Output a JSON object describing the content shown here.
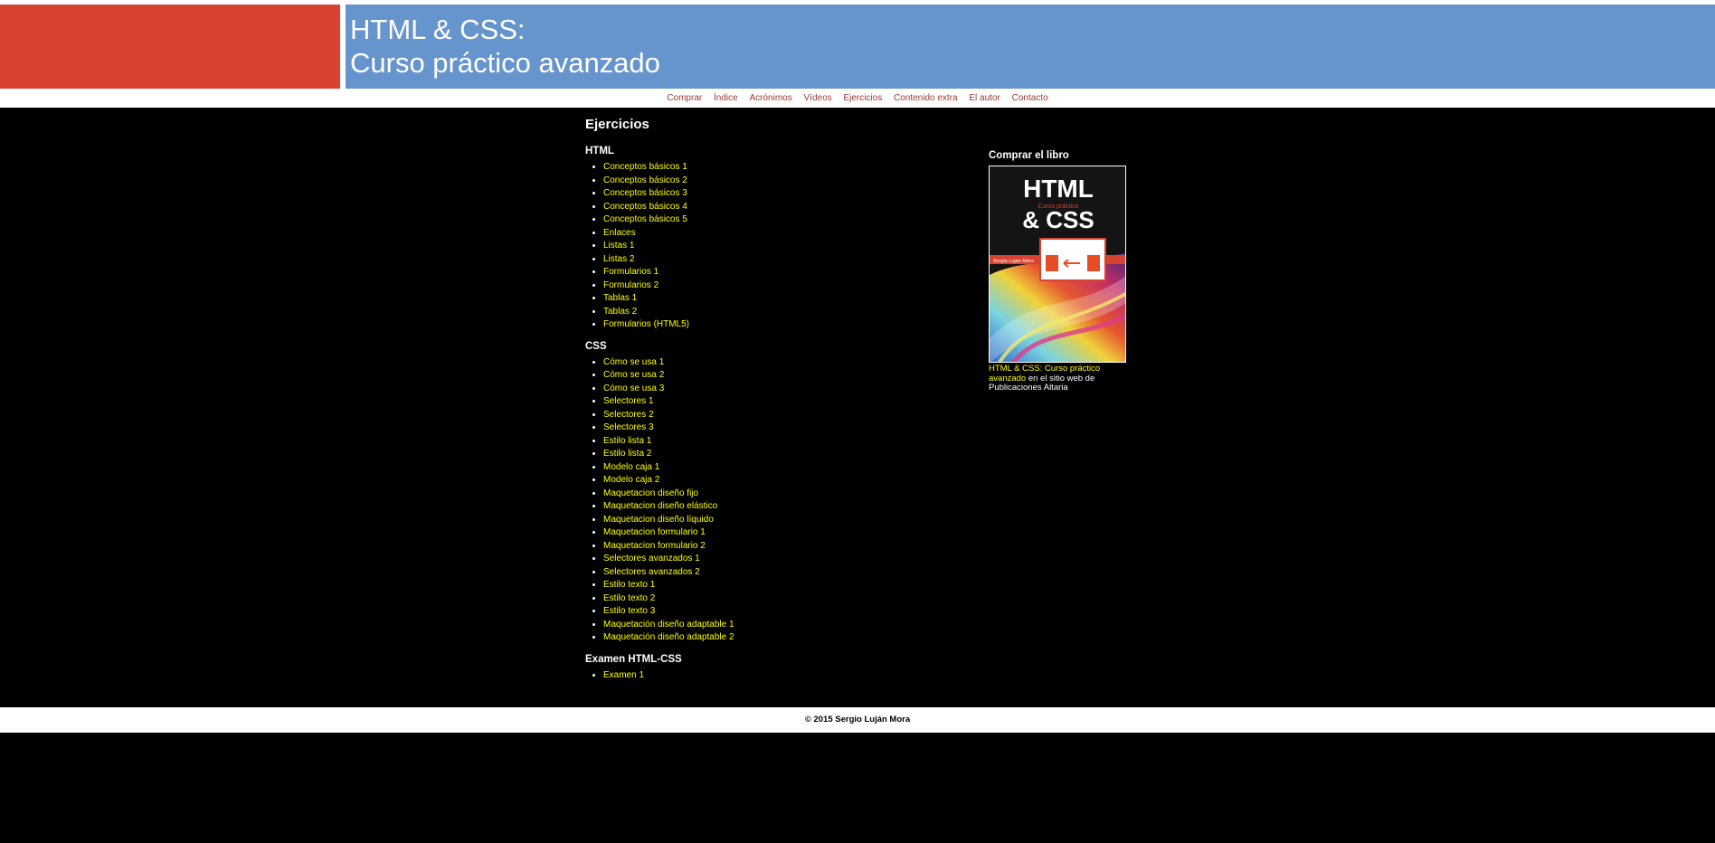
{
  "header": {
    "title_line1": "HTML & CSS:",
    "title_line2": "Curso práctico avanzado"
  },
  "nav": {
    "items": [
      "Comprar",
      "Índice",
      "Acrónimos",
      "Vídeos",
      "Ejercicios",
      "Contenido extra",
      "El autor",
      "Contacto"
    ]
  },
  "main": {
    "page_title": "Ejercicios",
    "sections": [
      {
        "title": "HTML",
        "items": [
          "Conceptos básicos 1",
          "Conceptos básicos 2",
          "Conceptos básicos 3",
          "Conceptos básicos 4",
          "Conceptos básicos 5",
          "Enlaces",
          "Listas 1",
          "Listas 2",
          "Formularios 1",
          "Formularios 2",
          "Tablas 1",
          "Tablas 2",
          "Formularios (HTML5)"
        ]
      },
      {
        "title": "CSS",
        "items": [
          "Cómo se usa 1",
          "Cómo se usa 2",
          "Cómo se usa 3",
          "Selectores 1",
          "Selectores 2",
          "Selectores 3",
          "Estilo lista 1",
          "Estilo lista 2",
          "Modelo caja 1",
          "Modelo caja 2",
          "Maquetacion diseño fijo",
          "Maquetacion diseño elástico",
          "Maquetacion diseño líquido",
          "Maquetacion formulario 1",
          "Maquetacion formulario 2",
          "Selectores avanzados 1",
          "Selectores avanzados 2",
          "Estilo texto 1",
          "Estilo texto 2",
          "Estilo texto 3",
          "Maquetación diseño adaptable 1",
          "Maquetación diseño adaptable 2"
        ]
      },
      {
        "title": "Examen HTML-CSS",
        "items": [
          "Examen 1"
        ]
      }
    ]
  },
  "sidebar": {
    "title": "Comprar el libro",
    "book": {
      "cover_title_1": "HTML",
      "cover_subtitle": "Curso práctico",
      "cover_title_2": "& CSS",
      "cover_author": "Sergio Luján Mora"
    },
    "caption_link": "HTML & CSS: Curso práctico avanzado",
    "caption_rest": " en el sitio web de Publicaciones Altaria"
  },
  "footer": {
    "text": "© 2015 Sergio Luján Mora"
  },
  "colors": {
    "header_red": "#d84230",
    "header_blue": "#6694cc",
    "nav_link": "#9b3a2e",
    "link": "#ffff00",
    "background": "#000000"
  }
}
